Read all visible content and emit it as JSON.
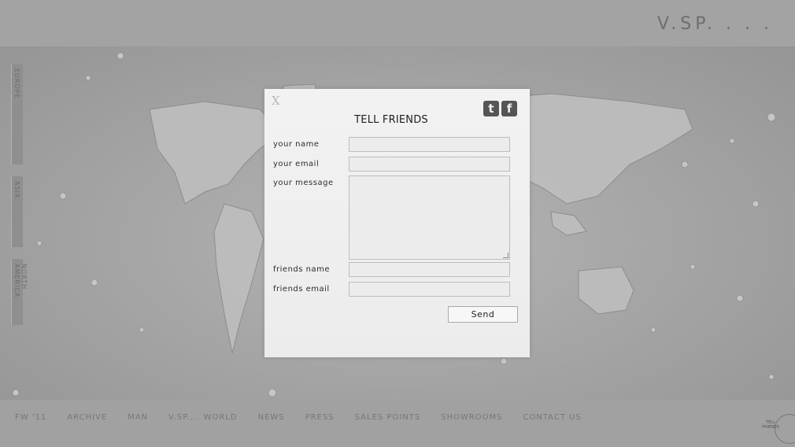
{
  "header": {
    "logo": "V.SP. . . ."
  },
  "region_tabs": [
    {
      "label": "EUROPE"
    },
    {
      "label": "ASIA"
    },
    {
      "label": "NORTH AMERICA"
    }
  ],
  "nav": {
    "items": [
      "FW '11",
      "ARCHIVE",
      "MAN",
      "V.SP.... WORLD",
      "NEWS",
      "PRESS",
      "SALES POINTS",
      "SHOWROOMS",
      "CONTACT US"
    ]
  },
  "badge": {
    "label_line1": "TELL",
    "label_line2": "FRIENDS"
  },
  "modal": {
    "close_label": "X",
    "title": "TELL FRIENDS",
    "twitter_glyph": "t",
    "facebook_glyph": "f",
    "fields": {
      "your_name": {
        "label": "your name",
        "value": ""
      },
      "your_email": {
        "label": "your email",
        "value": ""
      },
      "your_message": {
        "label": "your message",
        "value": ""
      },
      "friends_name": {
        "label": "friends name",
        "value": ""
      },
      "friends_email": {
        "label": "friends email",
        "value": ""
      }
    },
    "send_label": "Send"
  }
}
